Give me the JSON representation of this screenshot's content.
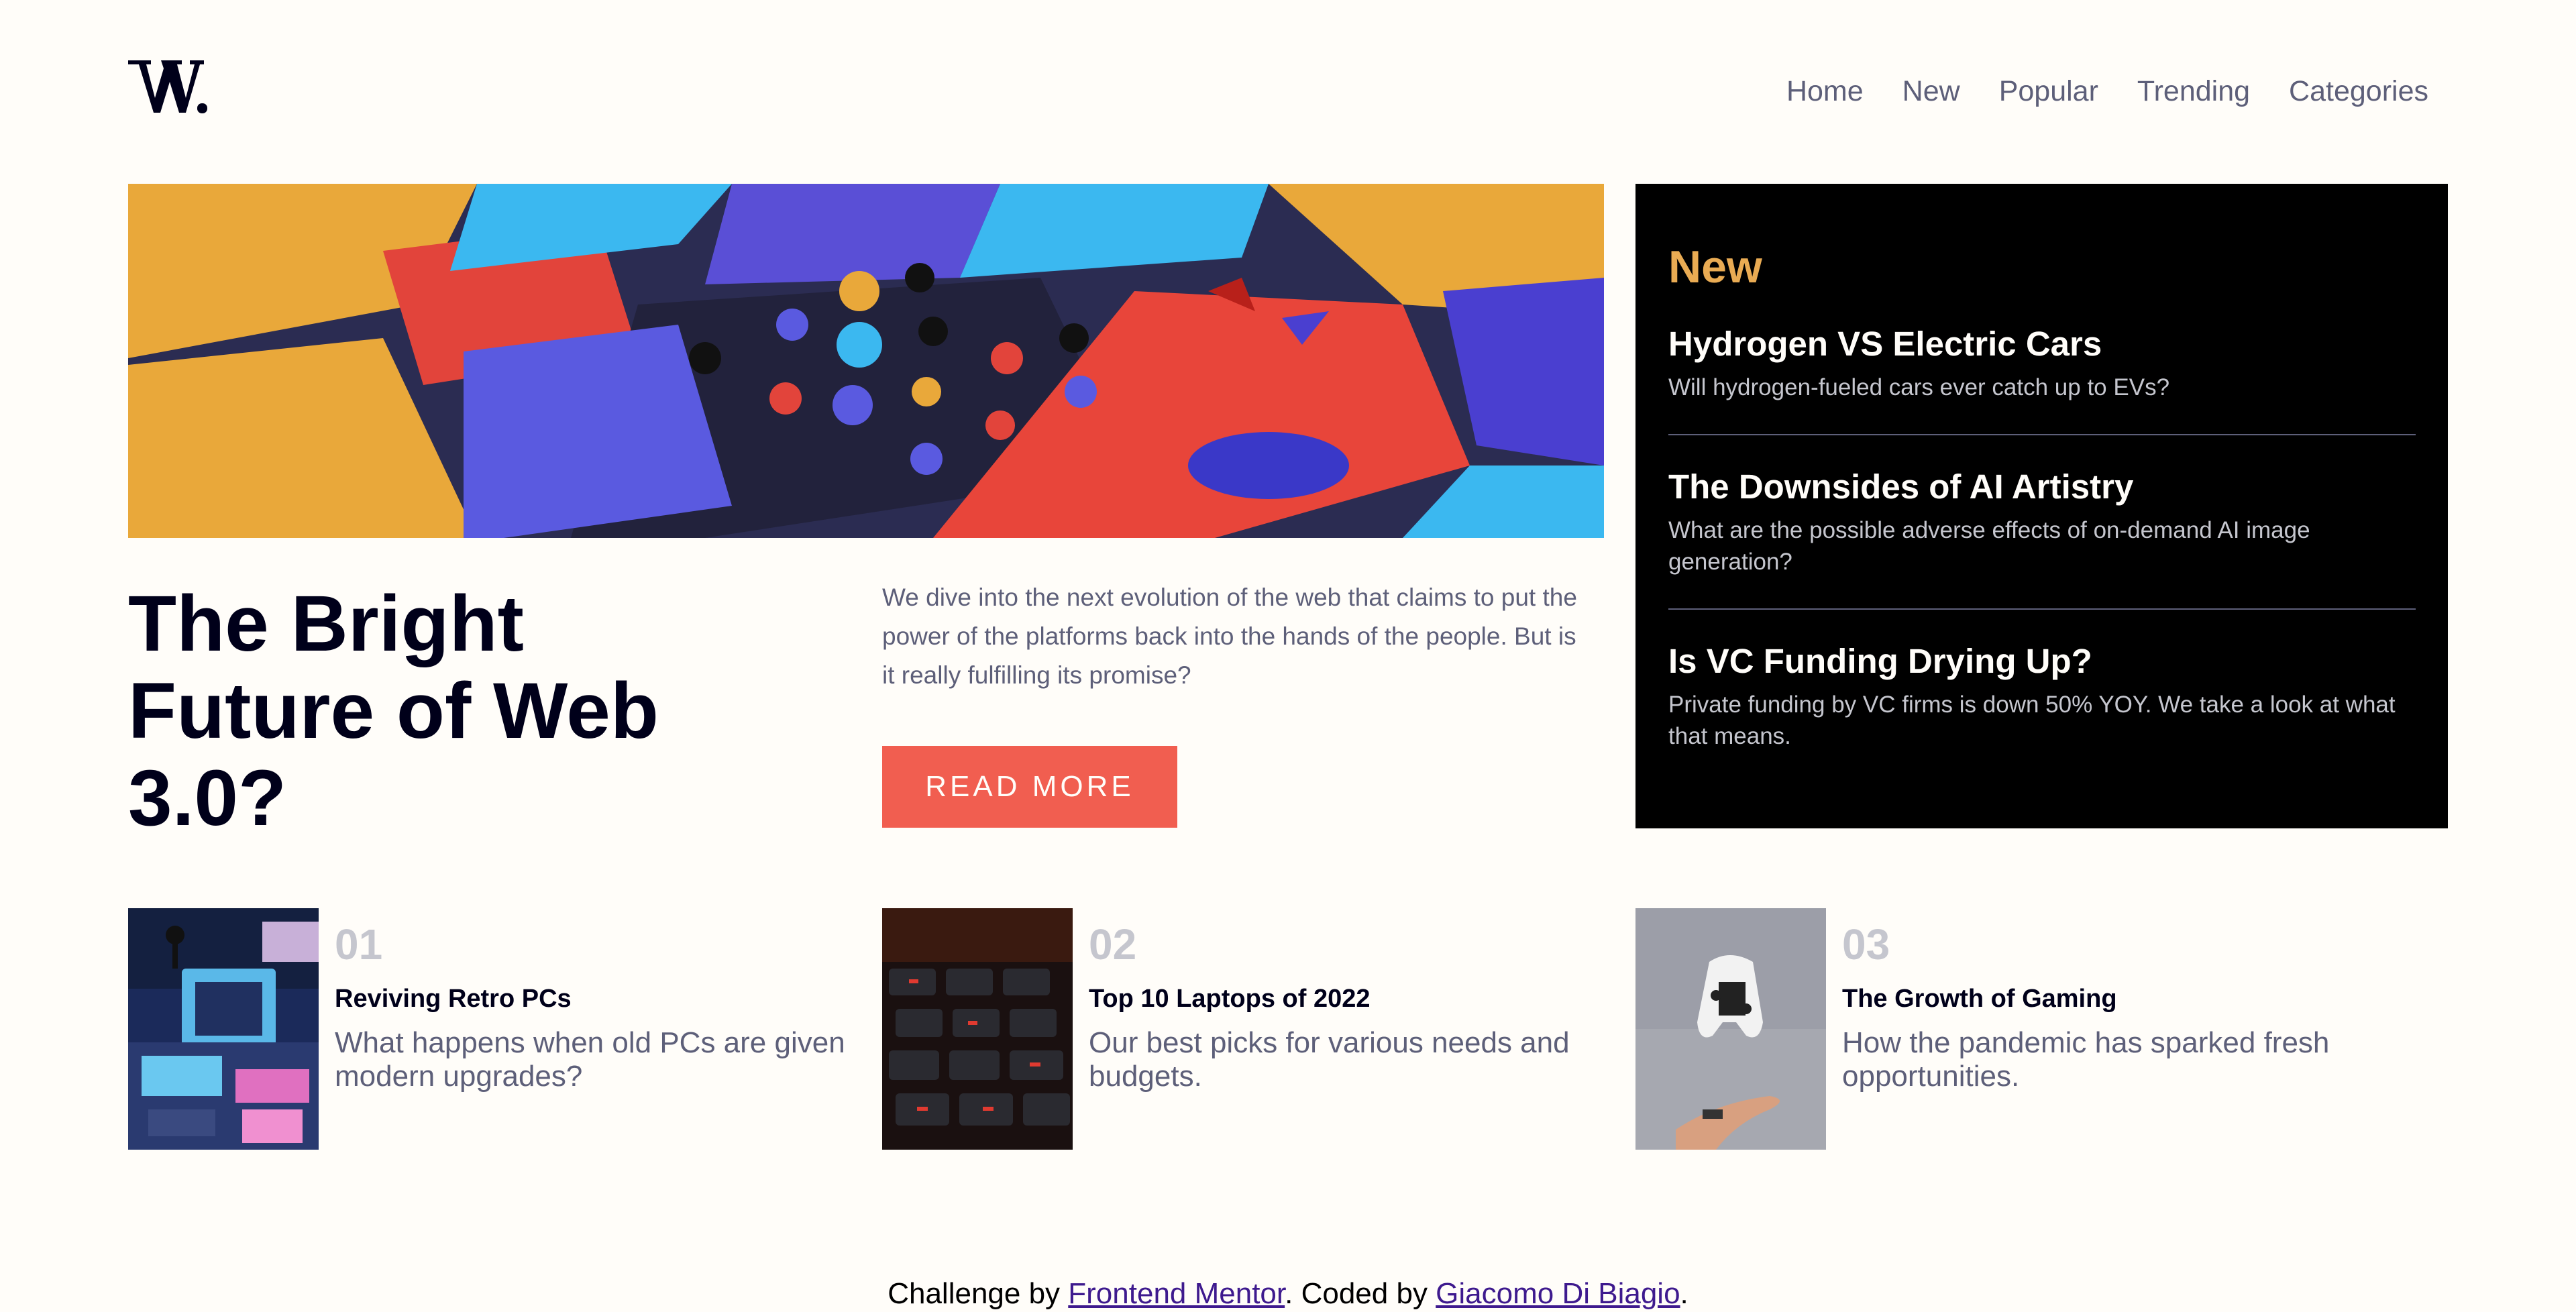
{
  "logo": {
    "text": "W."
  },
  "nav": {
    "items": [
      "Home",
      "New",
      "Popular",
      "Trending",
      "Categories"
    ]
  },
  "hero": {
    "title_lines": [
      "The Bright",
      "Future of Web",
      "3.0?"
    ],
    "text": "We dive into the next evolution of the web that claims to put the power of the platforms back into the hands of the people. But is it really fulfilling its promise?",
    "button_label": "READ MORE"
  },
  "new_panel": {
    "heading": "New",
    "items": [
      {
        "title": "Hydrogen VS Electric Cars",
        "desc": "Will hydrogen-fueled cars ever catch up to EVs?"
      },
      {
        "title": "The Downsides of AI Artistry",
        "desc": "What are the possible adverse effects of on-demand AI image generation?"
      },
      {
        "title": "Is VC Funding Drying Up?",
        "desc": "Private funding by VC firms is down 50% YOY. We take a look at what that means."
      }
    ]
  },
  "cards": [
    {
      "num": "01",
      "title": "Reviving Retro PCs",
      "desc": "What happens when old PCs are given modern upgrades?"
    },
    {
      "num": "02",
      "title": "Top 10 Laptops of 2022",
      "desc": "Our best picks for various needs and budgets."
    },
    {
      "num": "03",
      "title": "The Growth of Gaming",
      "desc": "How the pandemic has sparked fresh opportunities."
    }
  ],
  "footer": {
    "prefix": "Challenge by ",
    "link1": "Frontend Mentor",
    "middle": ". Coded by ",
    "link2": "Giacomo Di Biagio",
    "suffix": "."
  },
  "colors": {
    "accent": "#f15e50",
    "new_heading": "#e9ab53",
    "dark": "#00001a",
    "muted": "#5d5f79",
    "light_muted": "#c5c6ce",
    "background": "#fffdf9"
  }
}
